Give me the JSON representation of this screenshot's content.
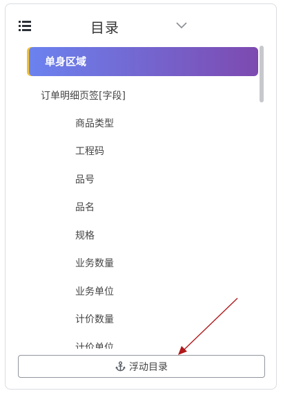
{
  "header": {
    "menu_icon": "list-icon",
    "title": "目录",
    "toggle_icon": "chevron-down-icon"
  },
  "toc": {
    "active_item": "单身区域",
    "section": "订单明细页签[字段]",
    "fields": [
      "商品类型",
      "工程码",
      "品号",
      "品名",
      "规格",
      "业务数量",
      "业务单位",
      "计价数量",
      "计价单位"
    ]
  },
  "footer": {
    "float_button_label": "浮动目录",
    "float_button_icon": "anchor-icon"
  },
  "colors": {
    "active_gradient_start": "#6b82ef",
    "active_gradient_end": "#7d4ab0",
    "active_indicator": "#f2c230",
    "annotation_arrow": "#b0191c"
  }
}
